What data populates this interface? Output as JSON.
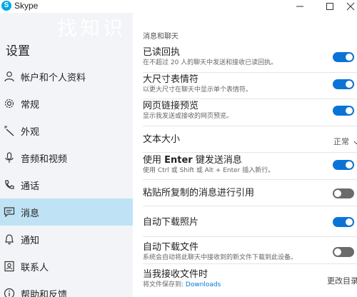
{
  "window": {
    "app_title": "Skype",
    "app_icon_letter": "S",
    "controls": [
      "minimize",
      "maximize",
      "close"
    ]
  },
  "watermark": "找知识",
  "sidebar": {
    "title": "设置",
    "items": [
      {
        "label": "帐户和个人资料",
        "icon": "person-icon",
        "active": false
      },
      {
        "label": "常规",
        "icon": "gear-icon",
        "active": false
      },
      {
        "label": "外观",
        "icon": "magic-wand-icon",
        "active": false
      },
      {
        "label": "音频和视频",
        "icon": "microphone-icon",
        "active": false
      },
      {
        "label": "通话",
        "icon": "phone-icon",
        "active": false
      },
      {
        "label": "消息",
        "icon": "message-icon",
        "active": true
      },
      {
        "label": "通知",
        "icon": "bell-icon",
        "active": false
      },
      {
        "label": "联系人",
        "icon": "contacts-icon",
        "active": false
      },
      {
        "label": "帮助和反馈",
        "icon": "info-icon",
        "active": false
      }
    ]
  },
  "main": {
    "section_title": "消息和聊天",
    "settings": [
      {
        "title": "已读回执",
        "desc": "在不超过 20 人的聊天中发送和接收已读回执。",
        "control": "toggle",
        "state": "on"
      },
      {
        "title": "大尺寸表情符",
        "desc": "以更大尺寸在聊天中显示单个表情符。",
        "control": "toggle",
        "state": "on"
      },
      {
        "title": "网页链接预览",
        "desc": "显示我发送或接收的网页预览。",
        "control": "toggle",
        "state": "on"
      },
      {
        "title": "文本大小",
        "desc": "",
        "control": "dropdown",
        "value": "正常",
        "chevron": "chevron-down-icon"
      },
      {
        "title_prefix": "使用 ",
        "title_bold": "Enter",
        "title_suffix": " 键发送消息",
        "desc": "使用 Ctrl 或 Shift 或 Alt + Enter 插入新行。",
        "control": "toggle",
        "state": "on"
      },
      {
        "title": "粘贴所复制的消息进行引用",
        "desc": "",
        "control": "toggle",
        "state": "off"
      },
      {
        "title": "自动下载照片",
        "desc": "",
        "control": "toggle",
        "state": "on"
      },
      {
        "title": "自动下载文件",
        "desc": "系统会自动将此聊天中接收到的新文件下载到此设备。",
        "control": "toggle",
        "state": "off"
      },
      {
        "title": "当我接收文件时",
        "desc_prefix": "将文件保存到: ",
        "desc_link": "Downloads",
        "control": "link",
        "value": "更改目录"
      }
    ]
  },
  "colors": {
    "accent": "#0a74d6",
    "sidebar_bg": "#f3f4f7",
    "active_bg": "#bfe3f5",
    "toggle_off": "#6b6b6b",
    "link": "#0078d4"
  }
}
